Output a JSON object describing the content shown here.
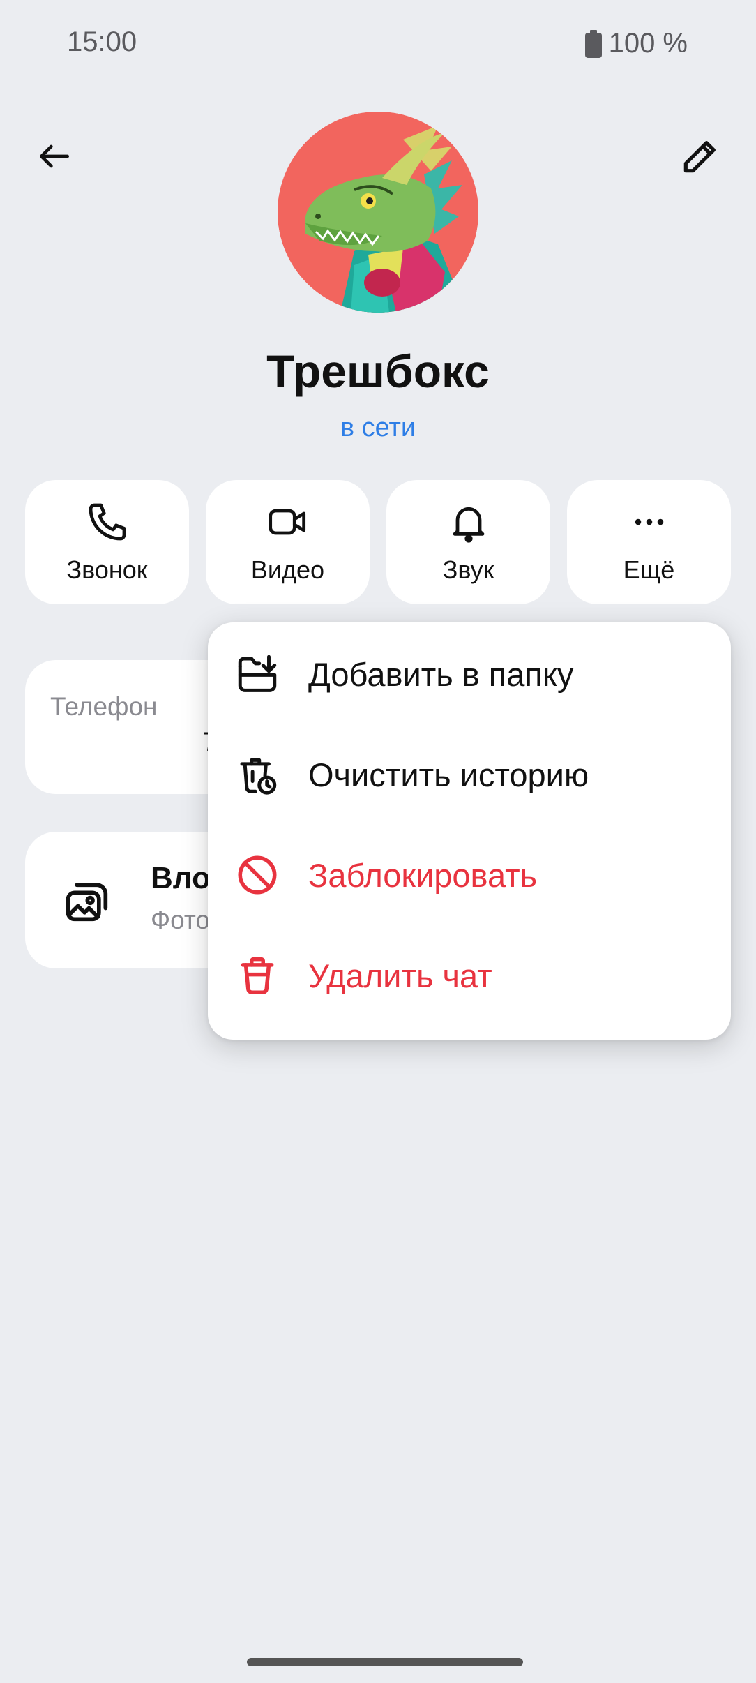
{
  "status_bar": {
    "time": "15:00",
    "battery": "100 %"
  },
  "profile": {
    "name": "Трешбокс",
    "status": "в сети"
  },
  "actions": [
    {
      "label": "Звонок",
      "icon": "phone-icon"
    },
    {
      "label": "Видео",
      "icon": "video-icon"
    },
    {
      "label": "Звук",
      "icon": "bell-icon"
    },
    {
      "label": "Ещё",
      "icon": "more-icon"
    }
  ],
  "info": {
    "phone_label": "Телефон",
    "phone_value": "7",
    "attachments_title": "Вло",
    "attachments_sub": "Фото"
  },
  "menu": [
    {
      "label": "Добавить в папку",
      "icon": "folder-download-icon"
    },
    {
      "label": "Очистить историю",
      "icon": "trash-clock-icon"
    },
    {
      "label": "Заблокировать",
      "icon": "block-icon"
    },
    {
      "label": "Удалить чат",
      "icon": "trash-icon"
    }
  ],
  "colors": {
    "accent": "#2e7ee6",
    "danger": "#e8333f",
    "background": "#ebedf1"
  }
}
